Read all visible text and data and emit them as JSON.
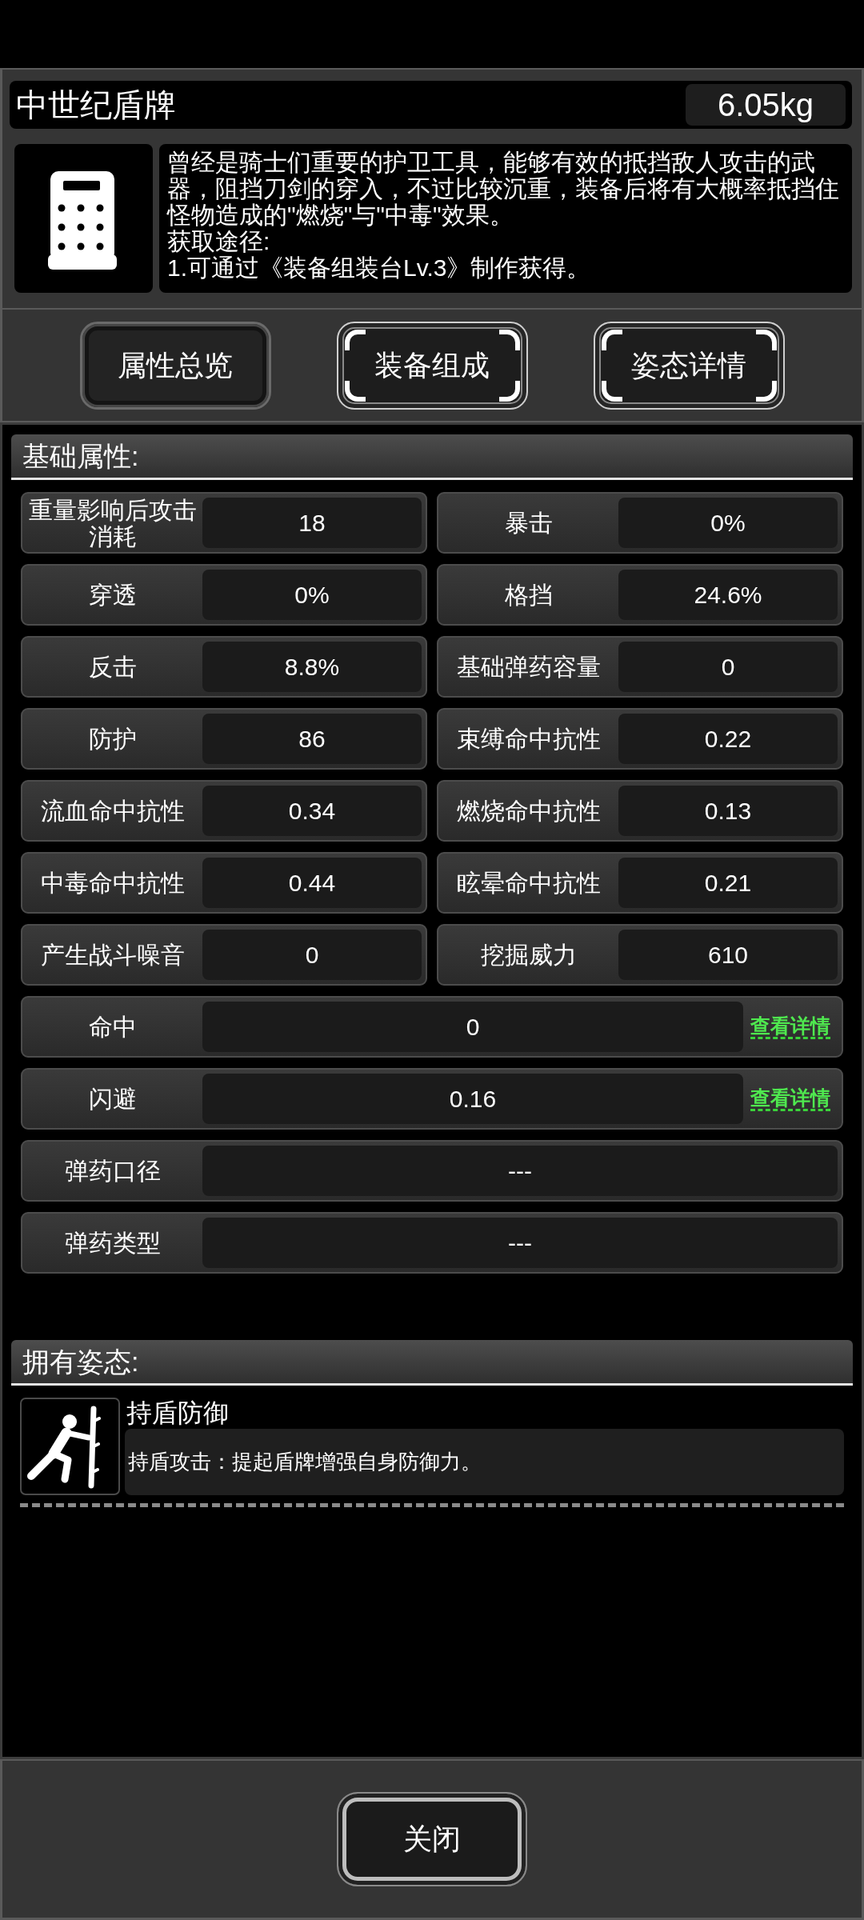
{
  "item": {
    "name": "中世纪盾牌",
    "weight": "6.05kg",
    "description": [
      "曾经是骑士们重要的护卫工具，能够有效的抵挡敌人攻击的武器，阻挡刀剑的穿入，不过比较沉重，装备后将有大概率抵挡住怪物造成的\"燃烧\"与\"中毒\"效果。",
      "获取途径:",
      "1.可通过《装备组装台Lv.3》制作获得。"
    ]
  },
  "tabs": [
    {
      "label": "属性总览",
      "selected": true
    },
    {
      "label": "装备组成",
      "selected": false
    },
    {
      "label": "姿态详情",
      "selected": false
    }
  ],
  "base_stats": {
    "title": "基础属性:",
    "stats": [
      {
        "kind": "half",
        "label": "重量影响后攻击消耗",
        "value": "18"
      },
      {
        "kind": "half",
        "label": "暴击",
        "value": "0%"
      },
      {
        "kind": "half",
        "label": "穿透",
        "value": "0%"
      },
      {
        "kind": "half",
        "label": "格挡",
        "value": "24.6%"
      },
      {
        "kind": "half",
        "label": "反击",
        "value": "8.8%"
      },
      {
        "kind": "half",
        "label": "基础弹药容量",
        "value": "0"
      },
      {
        "kind": "half",
        "label": "防护",
        "value": "86"
      },
      {
        "kind": "half",
        "label": "束缚命中抗性",
        "value": "0.22"
      },
      {
        "kind": "half",
        "label": "流血命中抗性",
        "value": "0.34"
      },
      {
        "kind": "half",
        "label": "燃烧命中抗性",
        "value": "0.13"
      },
      {
        "kind": "half",
        "label": "中毒命中抗性",
        "value": "0.44"
      },
      {
        "kind": "half",
        "label": "眩晕命中抗性",
        "value": "0.21"
      },
      {
        "kind": "half",
        "label": "产生战斗噪音",
        "value": "0"
      },
      {
        "kind": "half",
        "label": "挖掘威力",
        "value": "610"
      },
      {
        "kind": "full",
        "label": "命中",
        "value": "0",
        "link": "查看详情"
      },
      {
        "kind": "full",
        "label": "闪避",
        "value": "0.16",
        "link": "查看详情"
      },
      {
        "kind": "full",
        "label": "弹药口径",
        "value": "---"
      },
      {
        "kind": "full",
        "label": "弹药类型",
        "value": "---"
      }
    ]
  },
  "postures": {
    "title": "拥有姿态:",
    "items": [
      {
        "name": "持盾防御",
        "description": "持盾攻击：提起盾牌增强自身防御力。"
      }
    ]
  },
  "close_button": "关闭"
}
